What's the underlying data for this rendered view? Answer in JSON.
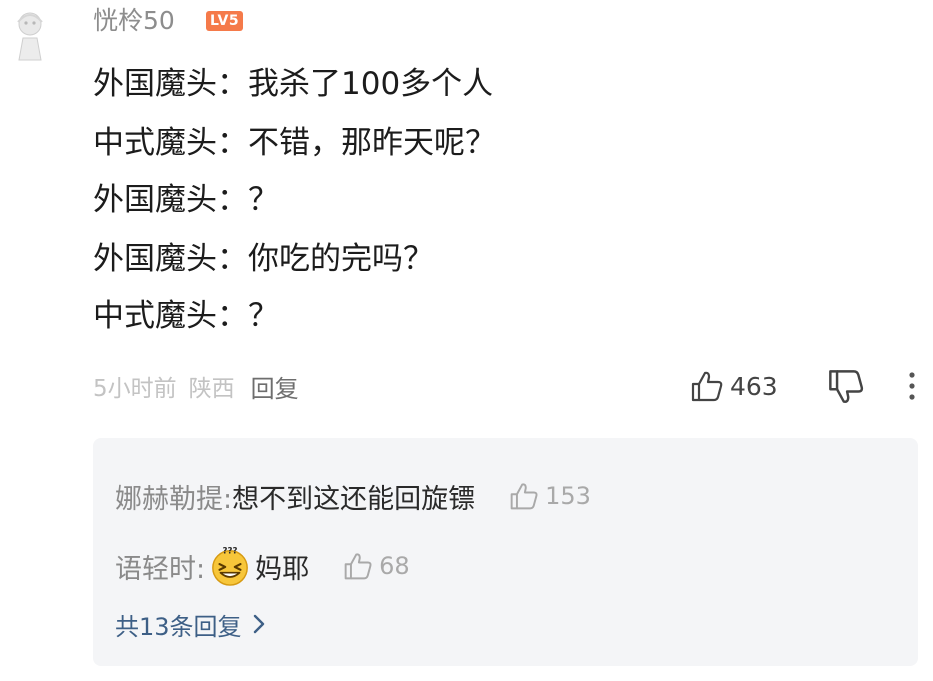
{
  "header": {
    "username": "恍柃50",
    "level_badge": "LV5"
  },
  "comment": {
    "lines": [
      "外国魔头：我杀了100多个人",
      "中式魔头：不错，那昨天呢？",
      "外国魔头：？",
      "外国魔头：你吃的完吗？",
      "中式魔头：？"
    ],
    "time": "5小时前",
    "location": "陕西",
    "reply_label": "回复",
    "like_count": "463"
  },
  "replies": {
    "items": [
      {
        "author": "娜赫勒提:",
        "text": "想不到这还能回旋镖",
        "emoji_icon": "",
        "like_count": "153"
      },
      {
        "author": "语轻时:",
        "text": "妈耶",
        "emoji_icon": "dizzy-grin-emoji-icon",
        "like_count": "68"
      }
    ],
    "total_label": "共13条回复"
  },
  "colors": {
    "level_badge": "#f57a4a",
    "link": "#3d5f86",
    "panel_bg": "#f4f5f7"
  }
}
